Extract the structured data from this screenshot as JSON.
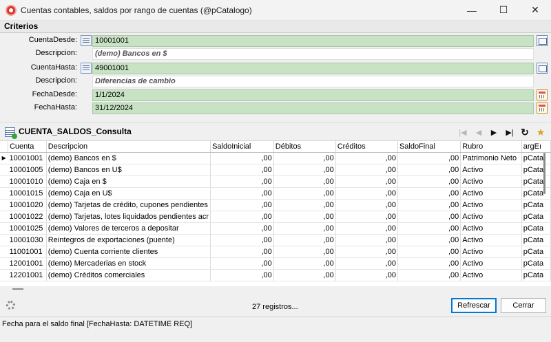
{
  "window": {
    "title": "Cuentas contables, saldos por rango de cuentas (@pCatalogo)",
    "minimize": "—",
    "maximize": "☐",
    "close": "✕"
  },
  "criterios": {
    "header": "Criterios",
    "cuenta_desde": {
      "label": "CuentaDesde:",
      "value": "10001001"
    },
    "desc_desde": {
      "label": "Descripcion:",
      "value": "(demo) Bancos en $"
    },
    "cuenta_hasta": {
      "label": "CuentaHasta:",
      "value": "49001001"
    },
    "desc_hasta": {
      "label": "Descripcion:",
      "value": "Diferencias de cambio"
    },
    "fecha_desde": {
      "label": "FechaDesde:",
      "value": "1/1/2024"
    },
    "fecha_hasta": {
      "label": "FechaHasta:",
      "value": "31/12/2024"
    }
  },
  "consulta": {
    "title": "CUENTA_SALDOS_Consulta",
    "nav": {
      "first": "|◀",
      "prev": "◀",
      "next": "▶",
      "last": "▶|",
      "refresh": "↻",
      "export": "★"
    }
  },
  "table": {
    "columns": [
      "Cuenta",
      "Descripcion",
      "SaldoInicial",
      "Débitos",
      "Créditos",
      "SaldoFinal",
      "Rubro",
      "argEı"
    ],
    "rows": [
      [
        "10001001",
        "(demo) Bancos en $",
        ",00",
        ",00",
        ",00",
        ",00",
        "Patrimonio Neto",
        "pCata"
      ],
      [
        "10001005",
        "(demo) Bancos en U$",
        ",00",
        ",00",
        ",00",
        ",00",
        "Activo",
        "pCata"
      ],
      [
        "10001010",
        "(demo) Caja en $",
        ",00",
        ",00",
        ",00",
        ",00",
        "Activo",
        "pCata"
      ],
      [
        "10001015",
        "(demo) Caja en U$",
        ",00",
        ",00",
        ",00",
        ",00",
        "Activo",
        "pCata"
      ],
      [
        "10001020",
        "(demo) Tarjetas de crédito, cupones pendientes",
        ",00",
        ",00",
        ",00",
        ",00",
        "Activo",
        "pCata"
      ],
      [
        "10001022",
        "(demo) Tarjetas, lotes liquidados pendientes acr",
        ",00",
        ",00",
        ",00",
        ",00",
        "Activo",
        "pCata"
      ],
      [
        "10001025",
        "(demo) Valores de terceros a depositar",
        ",00",
        ",00",
        ",00",
        ",00",
        "Activo",
        "pCata"
      ],
      [
        "10001030",
        "Reintegros de exportaciones (puente)",
        ",00",
        ",00",
        ",00",
        ",00",
        "Activo",
        "pCata"
      ],
      [
        "11001001",
        "(demo) Cuenta corriente clientes",
        ",00",
        ",00",
        ",00",
        ",00",
        "Activo",
        "pCata"
      ],
      [
        "12001001",
        "(demo) Mercaderias en stock",
        ",00",
        ",00",
        ",00",
        ",00",
        "Activo",
        "pCata"
      ],
      [
        "12201001",
        "(demo) Créditos comerciales",
        ",00",
        ",00",
        ",00",
        ",00",
        "Activo",
        "pCata"
      ]
    ]
  },
  "footer": {
    "count": "27 registros...",
    "refresh": "Refrescar",
    "close": "Cerrar"
  },
  "status": "Fecha para el saldo final [FechaHasta: DATETIME REQ]"
}
